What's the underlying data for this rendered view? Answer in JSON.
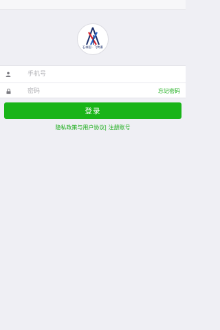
{
  "logo": {
    "caption": "石林国 · 飞鸭素"
  },
  "form": {
    "phone_placeholder": "手机号",
    "password_placeholder": "密码",
    "forgot_password": "忘记密码",
    "user_icon": "user-icon",
    "lock_icon": "lock-icon"
  },
  "login_button": "登录",
  "links": {
    "privacy": "隐私政策与用户协议",
    "separator": "|",
    "register": "注册账号"
  },
  "colors": {
    "accent": "#19b418",
    "background": "#efeff4"
  }
}
